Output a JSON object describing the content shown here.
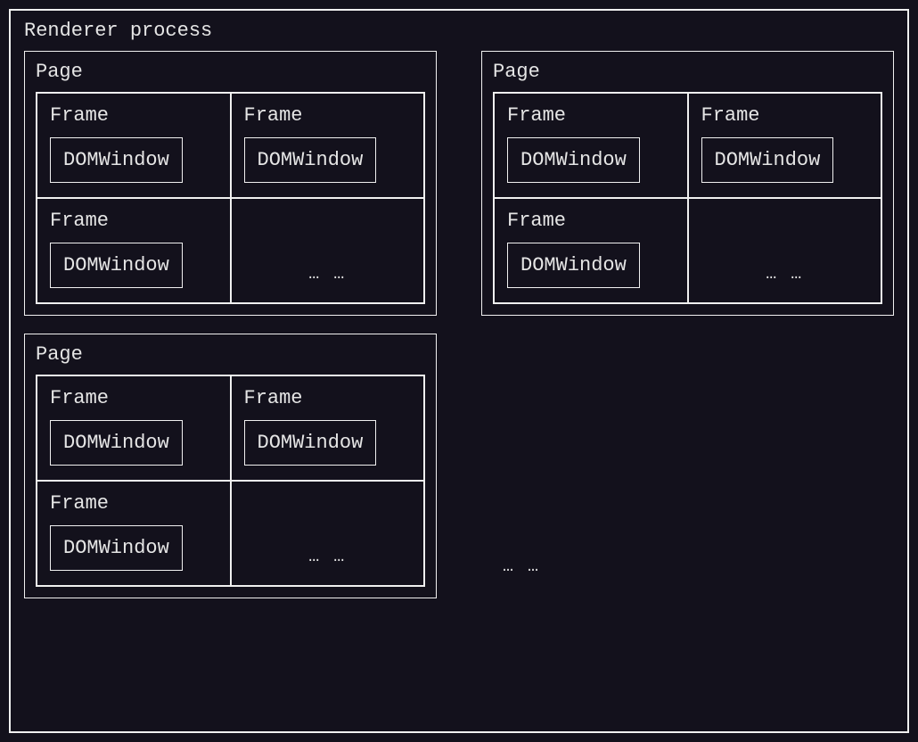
{
  "renderer": {
    "label": "Renderer process",
    "pages": [
      {
        "label": "Page",
        "frames": [
          {
            "label": "Frame",
            "window": "DOMWindow"
          },
          {
            "label": "Frame",
            "window": "DOMWindow"
          },
          {
            "label": "Frame",
            "window": "DOMWindow"
          }
        ],
        "ellipsis": "… …"
      },
      {
        "label": "Page",
        "frames": [
          {
            "label": "Frame",
            "window": "DOMWindow"
          },
          {
            "label": "Frame",
            "window": "DOMWindow"
          },
          {
            "label": "Frame",
            "window": "DOMWindow"
          }
        ],
        "ellipsis": "… …"
      },
      {
        "label": "Page",
        "frames": [
          {
            "label": "Frame",
            "window": "DOMWindow"
          },
          {
            "label": "Frame",
            "window": "DOMWindow"
          },
          {
            "label": "Frame",
            "window": "DOMWindow"
          }
        ],
        "ellipsis": "… …"
      }
    ],
    "outer_ellipsis": "… …"
  }
}
